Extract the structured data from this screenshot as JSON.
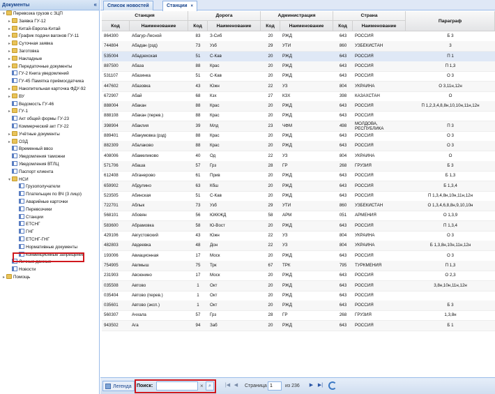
{
  "left_panel": {
    "title": "Документы",
    "collapse_icon": "«",
    "tree": [
      {
        "label": "Перевозка грузов с ЗЦП",
        "level": 0,
        "type": "folder",
        "expanded": true
      },
      {
        "label": "Заявка ГУ-12",
        "level": 1,
        "type": "folder"
      },
      {
        "label": "Китай-Европа-Китай",
        "level": 1,
        "type": "folder"
      },
      {
        "label": "График подачи вагонов ГУ-11",
        "level": 1,
        "type": "folder"
      },
      {
        "label": "Суточная заявка",
        "level": 1,
        "type": "folder"
      },
      {
        "label": "Заготовка",
        "level": 1,
        "type": "folder"
      },
      {
        "label": "Накладные",
        "level": 1,
        "type": "folder"
      },
      {
        "label": "Передаточные документы",
        "level": 1,
        "type": "folder"
      },
      {
        "label": "ГУ-2 Книга уведомлений",
        "level": 1,
        "type": "doc"
      },
      {
        "label": "ГУ-45 Памятка приёмосдатчика",
        "level": 1,
        "type": "doc"
      },
      {
        "label": "Накопительная карточка ФДУ-92",
        "level": 1,
        "type": "folder"
      },
      {
        "label": "ВУ",
        "level": 1,
        "type": "folder"
      },
      {
        "label": "Ведомость ГУ-46",
        "level": 1,
        "type": "doc"
      },
      {
        "label": "ГУ-1",
        "level": 1,
        "type": "folder"
      },
      {
        "label": "Акт общей формы ГУ-23",
        "level": 1,
        "type": "doc"
      },
      {
        "label": "Коммерческий акт ГУ-22",
        "level": 1,
        "type": "doc"
      },
      {
        "label": "Учётные документы",
        "level": 1,
        "type": "folder"
      },
      {
        "label": "ОЗД",
        "level": 1,
        "type": "folder"
      },
      {
        "label": "Временный ввоз",
        "level": 1,
        "type": "doc"
      },
      {
        "label": "Уведомления таможни",
        "level": 1,
        "type": "doc"
      },
      {
        "label": "Уведомления ВТЛЦ",
        "level": 1,
        "type": "doc"
      },
      {
        "label": "Паспорт клиента",
        "level": 1,
        "type": "doc"
      },
      {
        "label": "НСИ",
        "level": 1,
        "type": "folder",
        "expanded": true
      },
      {
        "label": "Грузополучатели",
        "level": 2,
        "type": "doc"
      },
      {
        "label": "Плательщик по ВЧ (3 лицо)",
        "level": 2,
        "type": "doc"
      },
      {
        "label": "Аварийные карточки",
        "level": 2,
        "type": "doc"
      },
      {
        "label": "Перевозчики",
        "level": 2,
        "type": "doc"
      },
      {
        "label": "Станции",
        "level": 2,
        "type": "doc",
        "selected": true
      },
      {
        "label": "ЕТСНГ",
        "level": 2,
        "type": "doc"
      },
      {
        "label": "ГНГ",
        "level": 2,
        "type": "doc"
      },
      {
        "label": "ЕТСНГ-ГНГ",
        "level": 2,
        "type": "doc"
      },
      {
        "label": "Нормативные документы",
        "level": 2,
        "type": "doc"
      },
      {
        "label": "Конвенционные запрещения",
        "level": 2,
        "type": "doc"
      },
      {
        "label": "Личные данные",
        "level": 1,
        "type": "doc"
      },
      {
        "label": "Новости",
        "level": 1,
        "type": "doc"
      },
      {
        "label": "Помощь",
        "level": 0,
        "type": "folder"
      }
    ]
  },
  "tabs": [
    {
      "label": "Список новостей",
      "active": false
    },
    {
      "label": "Станции",
      "active": true
    }
  ],
  "tab_close_icon": "×",
  "grid": {
    "group_headers": [
      "Станция",
      "Дорога",
      "Администрация",
      "Страна",
      "Параграф"
    ],
    "column_headers": [
      "Код",
      "Наименование",
      "Код",
      "Наименование",
      "Код",
      "Наименование",
      "Код",
      "Наименование"
    ],
    "rows": [
      [
        "864300",
        "Абагур-Лесной",
        "83",
        "З-Сиб",
        "20",
        "РЖД",
        "643",
        "РОССИЯ",
        "Б 3"
      ],
      [
        "744804",
        "Абадан (рзд)",
        "73",
        "Узб",
        "29",
        "УТИ",
        "860",
        "УЗБЕКИСТАН",
        "3"
      ],
      [
        "535004",
        "Абадзехская",
        "51",
        "С-Кав",
        "20",
        "РЖД",
        "643",
        "РОССИЯ",
        "П 1"
      ],
      [
        "887500",
        "Абаза",
        "88",
        "Крас",
        "20",
        "РЖД",
        "643",
        "РОССИЯ",
        "П 1,3"
      ],
      [
        "531107",
        "Абазинка",
        "51",
        "С-Кав",
        "20",
        "РЖД",
        "643",
        "РОССИЯ",
        "О 3"
      ],
      [
        "447602",
        "Абазовка",
        "43",
        "Южн",
        "22",
        "УЗ",
        "804",
        "УКРАИНА",
        "О 3,11н,12н"
      ],
      [
        "672907",
        "Абай",
        "68",
        "Кзх",
        "27",
        "КЗХ",
        "398",
        "КАЗАХСТАН",
        "О"
      ],
      [
        "888004",
        "Абакан",
        "88",
        "Крас",
        "20",
        "РЖД",
        "643",
        "РОССИЯ",
        "П 1,2,3,4,8,8н,10,10н,11н,12н"
      ],
      [
        "888108",
        "Абакан (перев.)",
        "88",
        "Крас",
        "20",
        "РЖД",
        "643",
        "РОССИЯ",
        ""
      ],
      [
        "398904",
        "Абаклия",
        "39",
        "Млд",
        "23",
        "ЧФМ",
        "498",
        "МОЛДОВА, РЕСПУБЛИКА",
        "П 3"
      ],
      [
        "889401",
        "Абакумовка (рзд)",
        "88",
        "Крас",
        "20",
        "РЖД",
        "643",
        "РОССИЯ",
        "О 3"
      ],
      [
        "882309",
        "Абалаково",
        "88",
        "Крас",
        "20",
        "РЖД",
        "643",
        "РОССИЯ",
        "О 3"
      ],
      [
        "408006",
        "Абамеликово",
        "40",
        "Од",
        "22",
        "УЗ",
        "804",
        "УКРАИНА",
        "О"
      ],
      [
        "571706",
        "Абаша",
        "57",
        "Грз",
        "28",
        "ГР",
        "268",
        "ГРУЗИЯ",
        "Б 3"
      ],
      [
        "612408",
        "Абганерово",
        "61",
        "Прив",
        "20",
        "РЖД",
        "643",
        "РОССИЯ",
        "Б 1,3"
      ],
      [
        "659902",
        "Абдулино",
        "63",
        "Кбш",
        "20",
        "РЖД",
        "643",
        "РОССИЯ",
        "Б 1,3,4"
      ],
      [
        "523505",
        "Абинская",
        "51",
        "С-Кав",
        "20",
        "РЖД",
        "643",
        "РОССИЯ",
        "П 1,3,4,8н,10н,11н,12н"
      ],
      [
        "722701",
        "Аблык",
        "73",
        "Узб",
        "29",
        "УТИ",
        "860",
        "УЗБЕКИСТАН",
        "О 1,3,4,6,8,8н,9,10,10н"
      ],
      [
        "568101",
        "Абовян",
        "56",
        "ЮККЖД",
        "58",
        "АРМ",
        "051",
        "АРМЕНИЯ",
        "О 1,3,9"
      ],
      [
        "583600",
        "Абрамовка",
        "58",
        "Ю-Вост",
        "20",
        "РЖД",
        "643",
        "РОССИЯ",
        "П 1,3,4"
      ],
      [
        "429106",
        "Августовский",
        "43",
        "Южн",
        "22",
        "УЗ",
        "804",
        "УКРАИНА",
        "О 3"
      ],
      [
        "482803",
        "Авдеевка",
        "48",
        "Дон",
        "22",
        "УЗ",
        "804",
        "УКРАИНА",
        "Б 1,3,8н,10н,11н,12н"
      ],
      [
        "193006",
        "Авиационная",
        "17",
        "Моск",
        "20",
        "РЖД",
        "643",
        "РОССИЯ",
        "О 3"
      ],
      [
        "754905",
        "Авлмыш",
        "75",
        "Трк",
        "67",
        "ТРК",
        "795",
        "ТУРКМЕНИЯ",
        "П 1,3"
      ],
      [
        "231903",
        "Авсюнино",
        "17",
        "Моск",
        "20",
        "РЖД",
        "643",
        "РОССИЯ",
        "О 2,3"
      ],
      [
        "035508",
        "Автово",
        "1",
        "Окт",
        "20",
        "РЖД",
        "643",
        "РОССИЯ",
        "3,8н,10н,11н,12н"
      ],
      [
        "035404",
        "Автово (перев.)",
        "1",
        "Окт",
        "20",
        "РЖД",
        "643",
        "РОССИЯ",
        ""
      ],
      [
        "035601",
        "Автово (эксп.)",
        "1",
        "Окт",
        "20",
        "РЖД",
        "643",
        "РОССИЯ",
        "Б 3"
      ],
      [
        "560307",
        "Ачхала",
        "57",
        "Грз",
        "28",
        "ГР",
        "268",
        "ГРУЗИЯ",
        "1,3,8н"
      ],
      [
        "943502",
        "Ага",
        "94",
        "Заб",
        "20",
        "РЖД",
        "643",
        "РОССИЯ",
        "Б 1"
      ]
    ]
  },
  "toolbar": {
    "legend_label": "Легенда",
    "search_label": "Поиск:",
    "search_value": "",
    "clear_icon": "×",
    "search_icon": "⌕",
    "page_label": "Страница",
    "page_value": "1",
    "of_label": "из 236",
    "first_icon": "|◀",
    "prev_icon": "◀",
    "next_icon": "▶",
    "last_icon": "▶|"
  }
}
